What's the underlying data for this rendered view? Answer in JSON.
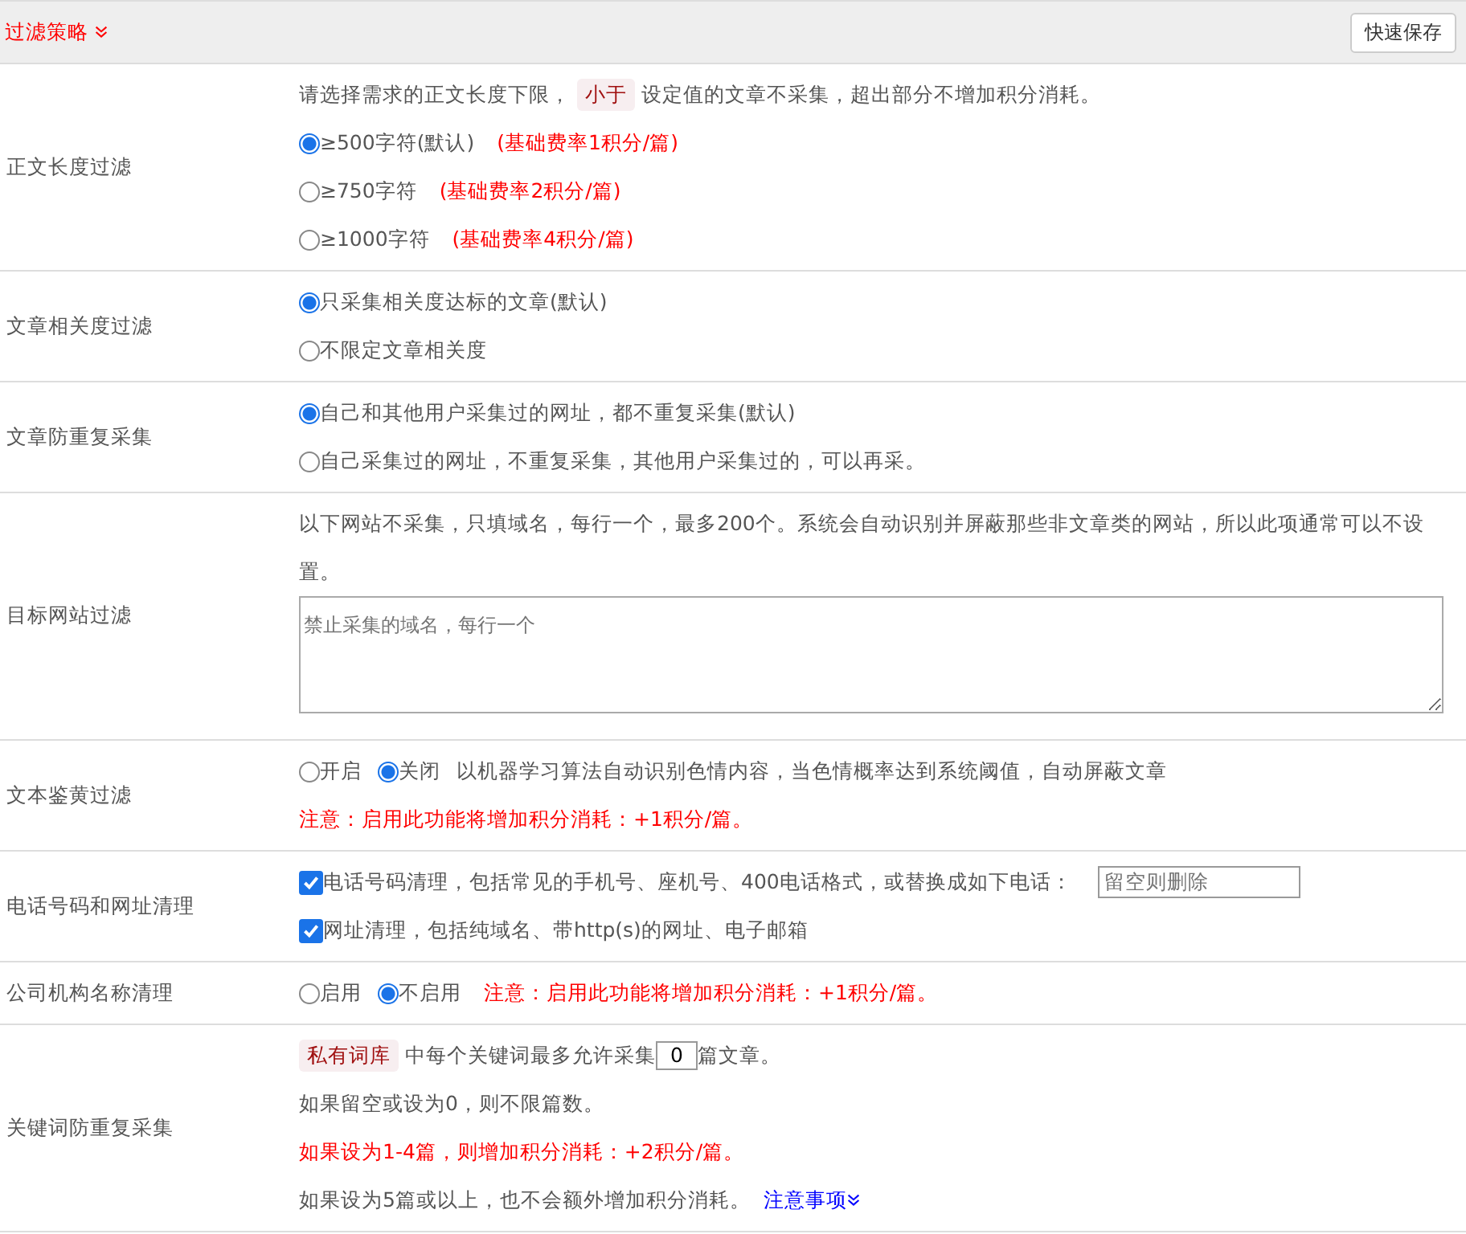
{
  "header": {
    "title": "过滤策略",
    "save_button": "快速保存"
  },
  "rows": [
    {
      "label": "正文长度过滤",
      "lines": [
        [
          {
            "kind": "text",
            "text": "请选择需求的正文长度下限，"
          },
          {
            "kind": "tag",
            "text": "小于"
          },
          {
            "kind": "text",
            "text": "设定值的文章不采集，超出部分不增加积分消耗。"
          }
        ],
        [
          {
            "kind": "radio",
            "text": "≥500字符(默认)",
            "selected": true
          },
          {
            "kind": "warn",
            "text": "(基础费率1积分/篇)"
          }
        ],
        [
          {
            "kind": "radio",
            "text": "≥750字符",
            "selected": false
          },
          {
            "kind": "warn",
            "text": "(基础费率2积分/篇)"
          }
        ],
        [
          {
            "kind": "radio",
            "text": "≥1000字符",
            "selected": false
          },
          {
            "kind": "warn",
            "text": "(基础费率4积分/篇)"
          }
        ]
      ]
    },
    {
      "label": "文章相关度过滤",
      "lines": [
        [
          {
            "kind": "radio",
            "text": "只采集相关度达标的文章(默认)",
            "selected": true
          }
        ],
        [
          {
            "kind": "radio",
            "text": "不限定文章相关度",
            "selected": false
          }
        ]
      ]
    },
    {
      "label": "文章防重复采集",
      "lines": [
        [
          {
            "kind": "radio",
            "text": "自己和其他用户采集过的网址，都不重复采集(默认)",
            "selected": true
          }
        ],
        [
          {
            "kind": "radio",
            "text": "自己采集过的网址，不重复采集，其他用户采集过的，可以再采。",
            "selected": false
          }
        ]
      ]
    },
    {
      "label": "目标网站过滤",
      "lines": [
        [
          {
            "kind": "text",
            "text": "以下网站不采集，只填域名，每行一个，最多200个。系统会自动识别并屏蔽那些非文章类的网站，所以此项通常可以不设置。"
          }
        ],
        [
          {
            "kind": "textarea",
            "placeholder": "禁止采集的域名，每行一个"
          }
        ]
      ]
    },
    {
      "label": "文本鉴黄过滤",
      "lines": [
        [
          {
            "kind": "radio",
            "text": "开启",
            "selected": false
          },
          {
            "kind": "radio",
            "text": "关闭",
            "selected": true
          },
          {
            "kind": "text",
            "text": "以机器学习算法自动识别色情内容，当色情概率达到系统阈值，自动屏蔽文章"
          }
        ],
        [
          {
            "kind": "warn",
            "text": "注意：启用此功能将增加积分消耗：+1积分/篇。"
          }
        ]
      ]
    },
    {
      "label": "电话号码和网址清理",
      "lines": [
        [
          {
            "kind": "checkbox",
            "text": "电话号码清理，包括常见的手机号、座机号、400电话格式，或替换成如下电话：",
            "checked": true
          },
          {
            "kind": "field",
            "placeholder": "留空则删除"
          }
        ],
        [
          {
            "kind": "checkbox",
            "text": "网址清理，包括纯域名、带http(s)的网址、电子邮箱",
            "checked": true
          }
        ]
      ]
    },
    {
      "label": "公司机构名称清理",
      "lines": [
        [
          {
            "kind": "radio",
            "text": "启用",
            "selected": false
          },
          {
            "kind": "radio",
            "text": "不启用",
            "selected": true
          },
          {
            "kind": "warn",
            "text": "注意：启用此功能将增加积分消耗：+1积分/篇。"
          }
        ]
      ]
    },
    {
      "label": "关键词防重复采集",
      "lines": [
        [
          {
            "kind": "tag",
            "text": "私有词库"
          },
          {
            "kind": "text",
            "text": "中每个关键词最多允许采集"
          },
          {
            "kind": "number",
            "value": "0"
          },
          {
            "kind": "text",
            "text": "篇文章。"
          }
        ],
        [
          {
            "kind": "text",
            "text": "如果留空或设为0，则不限篇数。"
          }
        ],
        [
          {
            "kind": "warn",
            "text": "如果设为1-4篇，则增加积分消耗：+2积分/篇。"
          }
        ],
        [
          {
            "kind": "text",
            "text": "如果设为5篇或以上，也不会额外增加积分消耗。"
          },
          {
            "kind": "link",
            "text": "注意事项"
          }
        ]
      ]
    }
  ]
}
